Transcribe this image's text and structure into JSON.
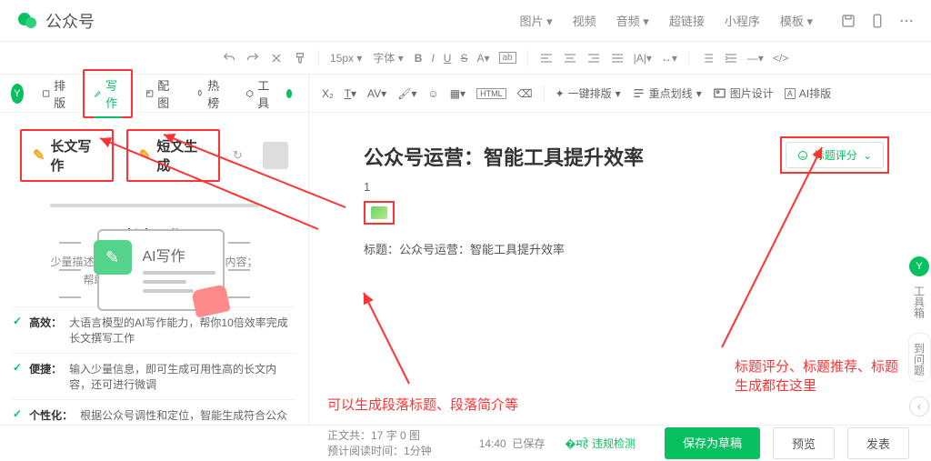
{
  "header": {
    "app_name": "公众号",
    "menu": [
      "图片",
      "视频",
      "音频",
      "超链接",
      "小程序",
      "模板"
    ]
  },
  "toolbar": {
    "font_size": "15px",
    "font_family": "字体"
  },
  "sidebar": {
    "tabs": [
      {
        "label": "排版"
      },
      {
        "label": "写作"
      },
      {
        "label": "配图"
      },
      {
        "label": "热榜"
      },
      {
        "label": "工具"
      }
    ],
    "modes": {
      "long": "长文写作",
      "short": "短文生成"
    },
    "illus_label": "AI写作",
    "feature_title": "长文写作",
    "feature_desc_1": "少量描述性输入，即可一键生成文章内容；",
    "feature_desc_2": "帮助运营者提高内容产出效率",
    "feat_items": [
      {
        "key": "高效：",
        "text": "大语言模型的AI写作能力，帮你10倍效率完成长文撰写工作"
      },
      {
        "key": "便捷：",
        "text": "输入少量信息，即可生成可用性高的长文内容，还可进行微调"
      },
      {
        "key": "个性化：",
        "text": "根据公众号调性和定位，智能生成符合公众号风格的内容"
      }
    ]
  },
  "editor_toolbar": {
    "quick_layout": "一键排版",
    "key_outline": "重点划线",
    "pic_design": "图片设计",
    "ai_layout": "AI排版"
  },
  "doc": {
    "title": "公众号运营：智能工具提升效率",
    "num": "1",
    "line_prefix": "标题：",
    "line_text": "公众号运营：智能工具提升效率"
  },
  "title_score_label": "标题评分",
  "annotations": {
    "left": "可以生成段落标题、段落简介等",
    "right_1": "标题评分、标题推荐、标题",
    "right_2": "生成都在这里"
  },
  "status": {
    "body_label": "正文共：",
    "body_value": "17 字 0 图",
    "read_label": "预计阅读时间：",
    "read_value": "1分钟",
    "time": "14:40",
    "saved": "已保存",
    "violation": "违规检测",
    "save_draft": "保存为草稿",
    "preview": "预览",
    "publish": "发表"
  },
  "rail": {
    "toolbox": "工具箱",
    "faq": "到问题"
  }
}
